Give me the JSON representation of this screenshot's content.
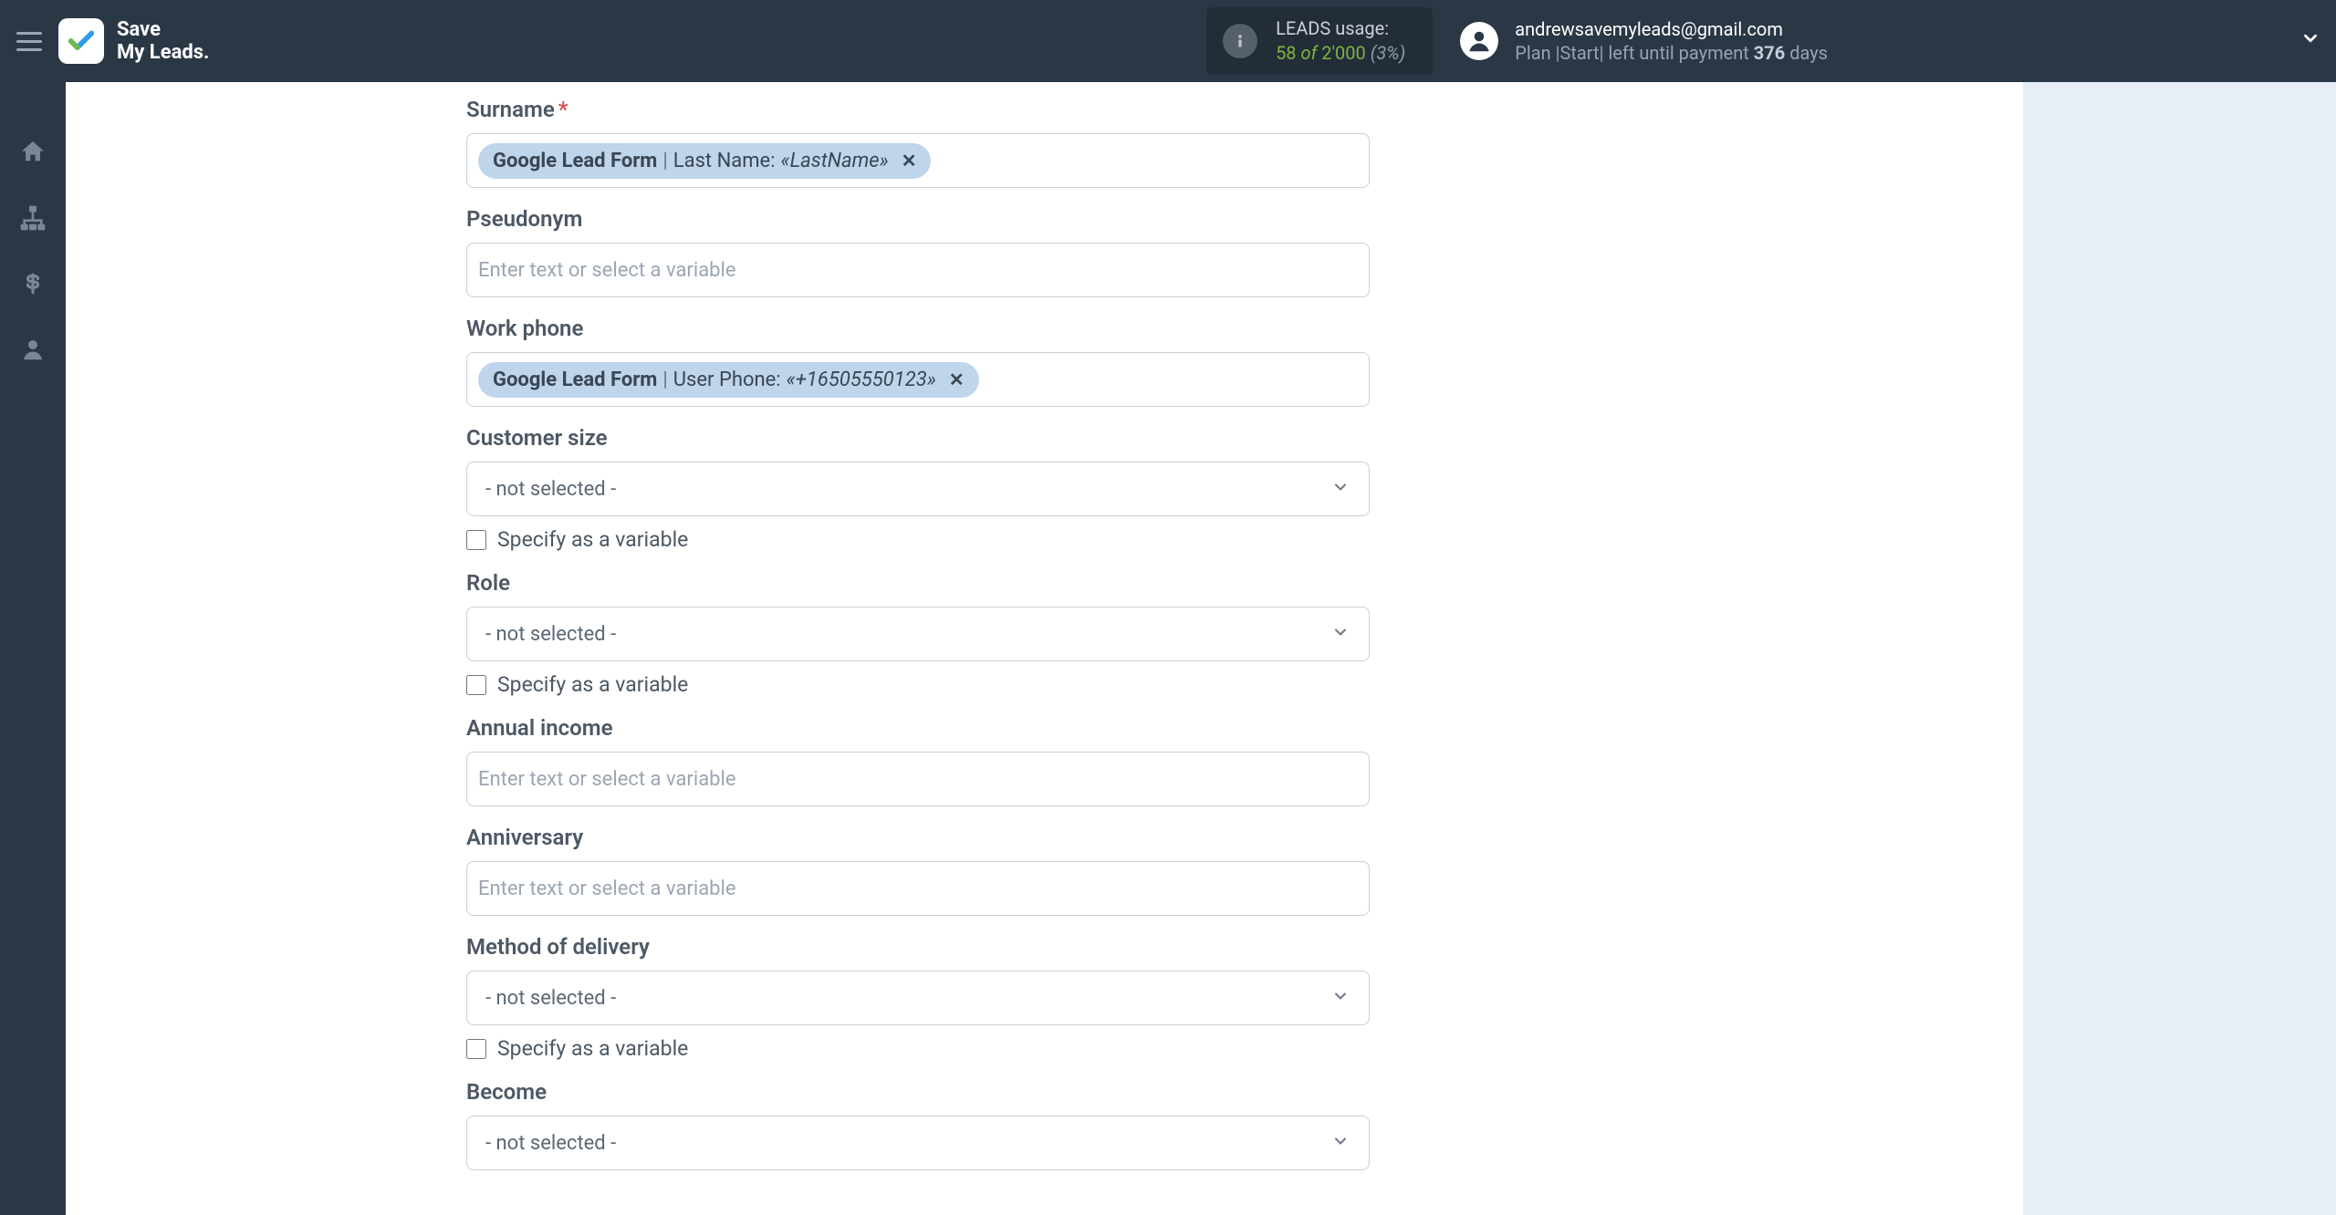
{
  "header": {
    "app_name_line1": "Save",
    "app_name_line2": "My Leads.",
    "leads_usage": {
      "label": "LEADS usage:",
      "used": "58",
      "of": "of",
      "total": "2'000",
      "percent": "(3%)"
    },
    "account": {
      "email": "andrewsavemyleads@gmail.com",
      "plan_prefix": "Plan |Start| left until payment ",
      "plan_days": "376",
      "plan_suffix": " days"
    }
  },
  "form": {
    "surname": {
      "label": "Surname",
      "chip_source": "Google Lead Form",
      "chip_field": "Last Name:",
      "chip_value": "«LastName»"
    },
    "pseudonym": {
      "label": "Pseudonym",
      "placeholder": "Enter text or select a variable"
    },
    "work_phone": {
      "label": "Work phone",
      "chip_source": "Google Lead Form",
      "chip_field": "User Phone:",
      "chip_value": "«+16505550123»"
    },
    "customer_size": {
      "label": "Customer size",
      "selected": "- not selected -",
      "checkbox_label": "Specify as a variable"
    },
    "role": {
      "label": "Role",
      "selected": "- not selected -",
      "checkbox_label": "Specify as a variable"
    },
    "annual_income": {
      "label": "Annual income",
      "placeholder": "Enter text or select a variable"
    },
    "anniversary": {
      "label": "Anniversary",
      "placeholder": "Enter text or select a variable"
    },
    "method_of_delivery": {
      "label": "Method of delivery",
      "selected": "- not selected -",
      "checkbox_label": "Specify as a variable"
    },
    "become": {
      "label": "Become",
      "selected": "- not selected -"
    }
  }
}
